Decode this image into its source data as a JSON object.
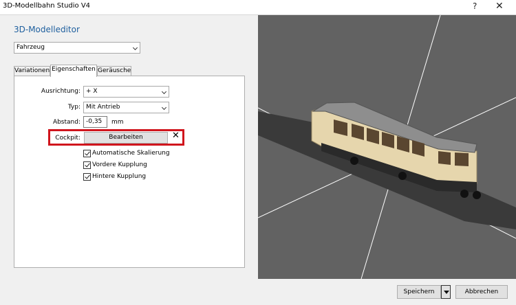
{
  "window": {
    "title": "3D-Modellbahn Studio V4",
    "help_glyph": "?",
    "close_glyph": "✕"
  },
  "editor": {
    "title": "3D-Modelleditor",
    "object_type": "Fahrzeug"
  },
  "tabs": [
    {
      "label": "Variationen",
      "active": false
    },
    {
      "label": "Eigenschaften",
      "active": true
    },
    {
      "label": "Geräusche",
      "active": false
    }
  ],
  "properties": {
    "ausrichtung_label": "Ausrichtung:",
    "ausrichtung_value": "+ X",
    "typ_label": "Typ:",
    "typ_value": "Mit Antrieb",
    "abstand_label": "Abstand:",
    "abstand_value": "-0,35",
    "abstand_unit": "mm",
    "cockpit_label": "Cockpit:",
    "cockpit_button": "Bearbeiten",
    "cockpit_clear": "✕"
  },
  "checkboxes": [
    {
      "label": "Automatische Skalierung",
      "checked": true
    },
    {
      "label": "Vordere Kupplung",
      "checked": true
    },
    {
      "label": "Hintere Kupplung",
      "checked": true
    }
  ],
  "footer": {
    "save_label": "Speichern",
    "cancel_label": "Abbrechen"
  },
  "colors": {
    "accent_title": "#1e5f9e",
    "highlight_border": "#d0141c",
    "viewport_bg": "#626262",
    "railcar_body": "#e6d6ad"
  }
}
